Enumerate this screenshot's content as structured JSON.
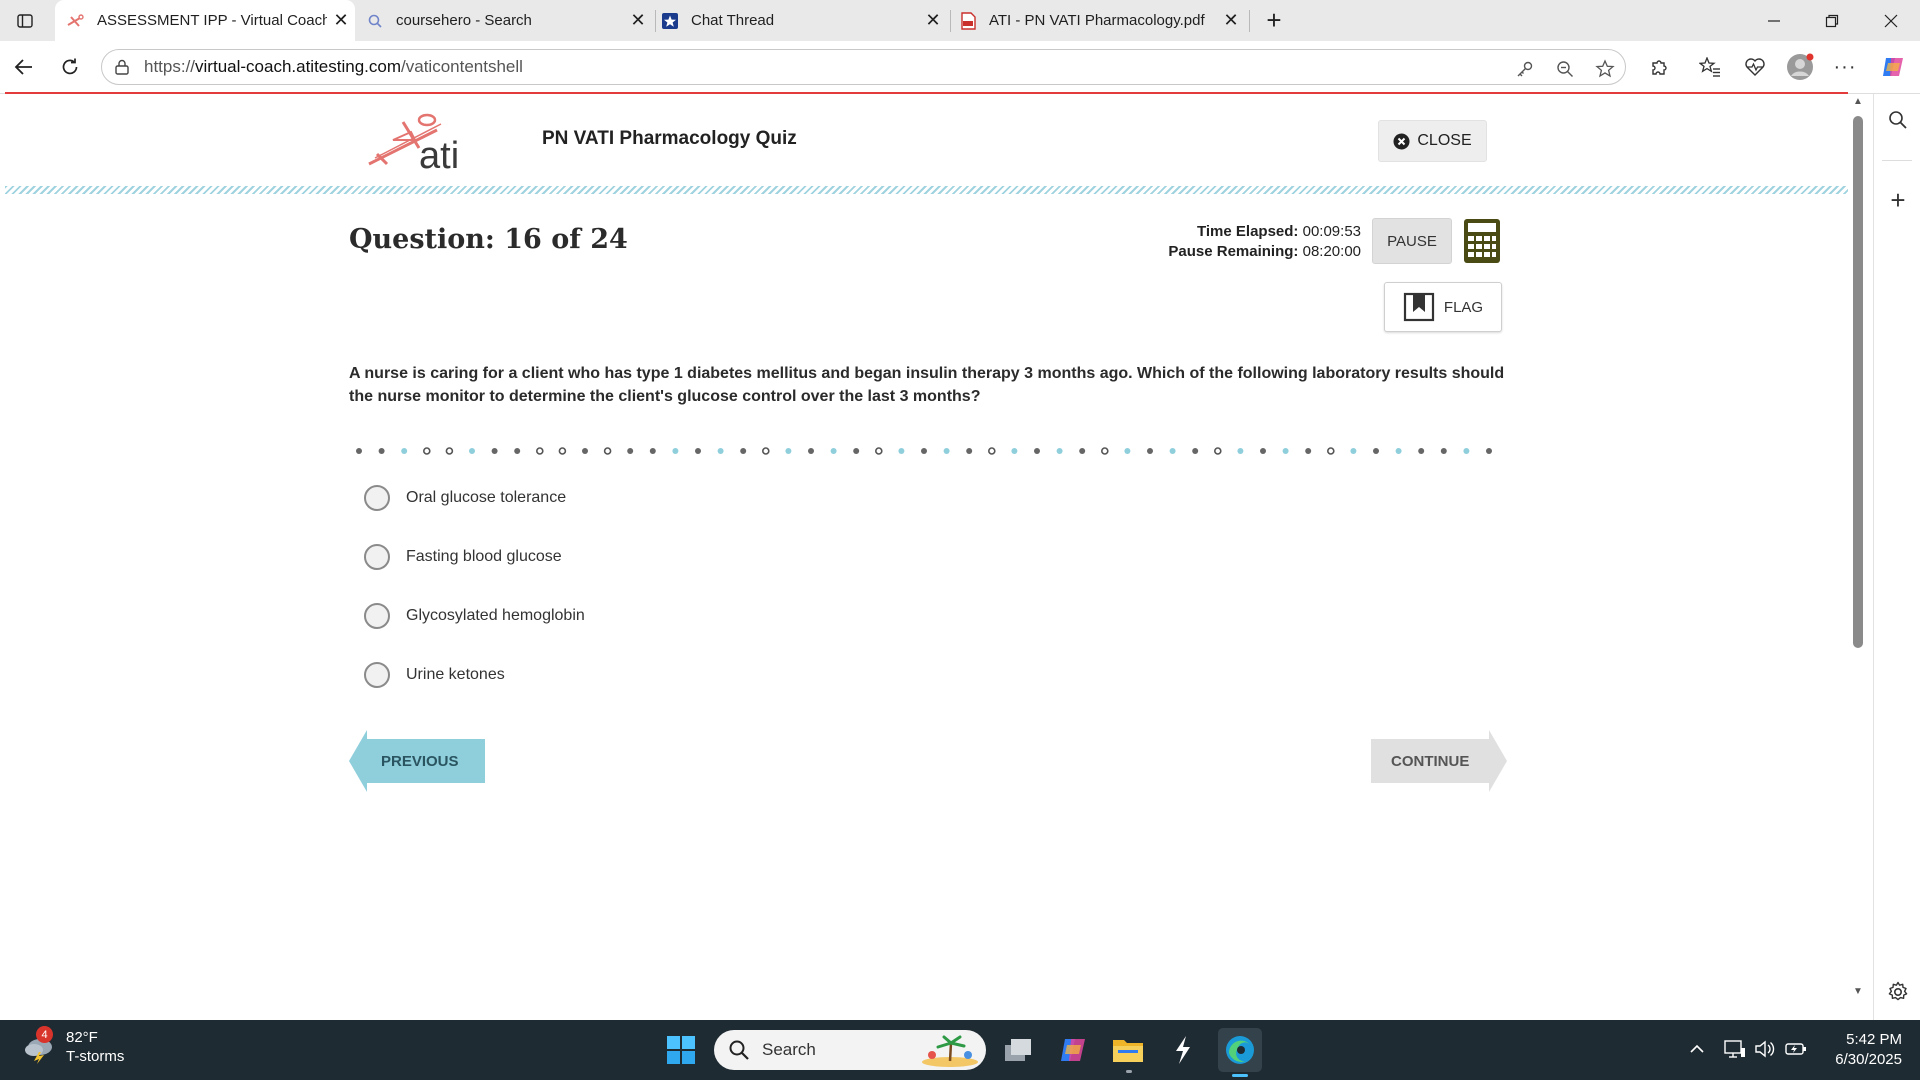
{
  "browser": {
    "tabs": [
      {
        "label": "ASSESSMENT IPP - Virtual Coach",
        "active": true
      },
      {
        "label": "coursehero - Search",
        "active": false
      },
      {
        "label": "Chat Thread",
        "active": false
      },
      {
        "label": "ATI - PN VATI Pharmacology.pdf",
        "active": false
      }
    ],
    "url_prefix": "https://",
    "url_host": "virtual-coach.atitesting.com",
    "url_path": "/vaticontentshell"
  },
  "header": {
    "logo_text": "ati",
    "quiz_title": "PN VATI Pharmacology Quiz",
    "close_label": "CLOSE"
  },
  "question": {
    "counter": "Question: 16 of 24",
    "time_elapsed_label": "Time Elapsed:",
    "time_elapsed": "00:09:53",
    "pause_remaining_label": "Pause Remaining:",
    "pause_remaining": "08:20:00",
    "pause_label": "PAUSE",
    "flag_label": "FLAG",
    "text": "A nurse is caring for a client who has type 1 diabetes mellitus and began insulin therapy 3 months ago. Which of the following laboratory results should the nurse monitor to determine the client's glucose control over the last 3 months?",
    "options": [
      "Oral glucose tolerance",
      "Fasting blood glucose",
      "Glycosylated hemoglobin",
      "Urine ketones"
    ]
  },
  "navigation": {
    "previous_label": "PREVIOUS",
    "continue_label": "CONTINUE"
  },
  "taskbar": {
    "weather_badge": "4",
    "temperature": "82°F",
    "condition": "T-storms",
    "search_placeholder": "Search",
    "time": "5:42 PM",
    "date": "6/30/2025"
  },
  "colors": {
    "accent_teal": "#8fcfdc",
    "alert_red": "#e33b3b",
    "calculator_green": "#4a4a14",
    "continue_gray": "#e0e0e0"
  },
  "icons": {
    "tab_favicons": [
      "ati-favicon-icon",
      "search-icon",
      "star-badge-icon",
      "pdf-icon"
    ],
    "toolbar": [
      "back-arrow-icon",
      "refresh-icon",
      "site-info-icon",
      "key-icon",
      "zoom-out-icon",
      "favorite-star-icon",
      "extensions-icon",
      "favorites-icon",
      "heartbeat-icon",
      "profile-icon",
      "more-icon",
      "copilot-icon"
    ]
  }
}
